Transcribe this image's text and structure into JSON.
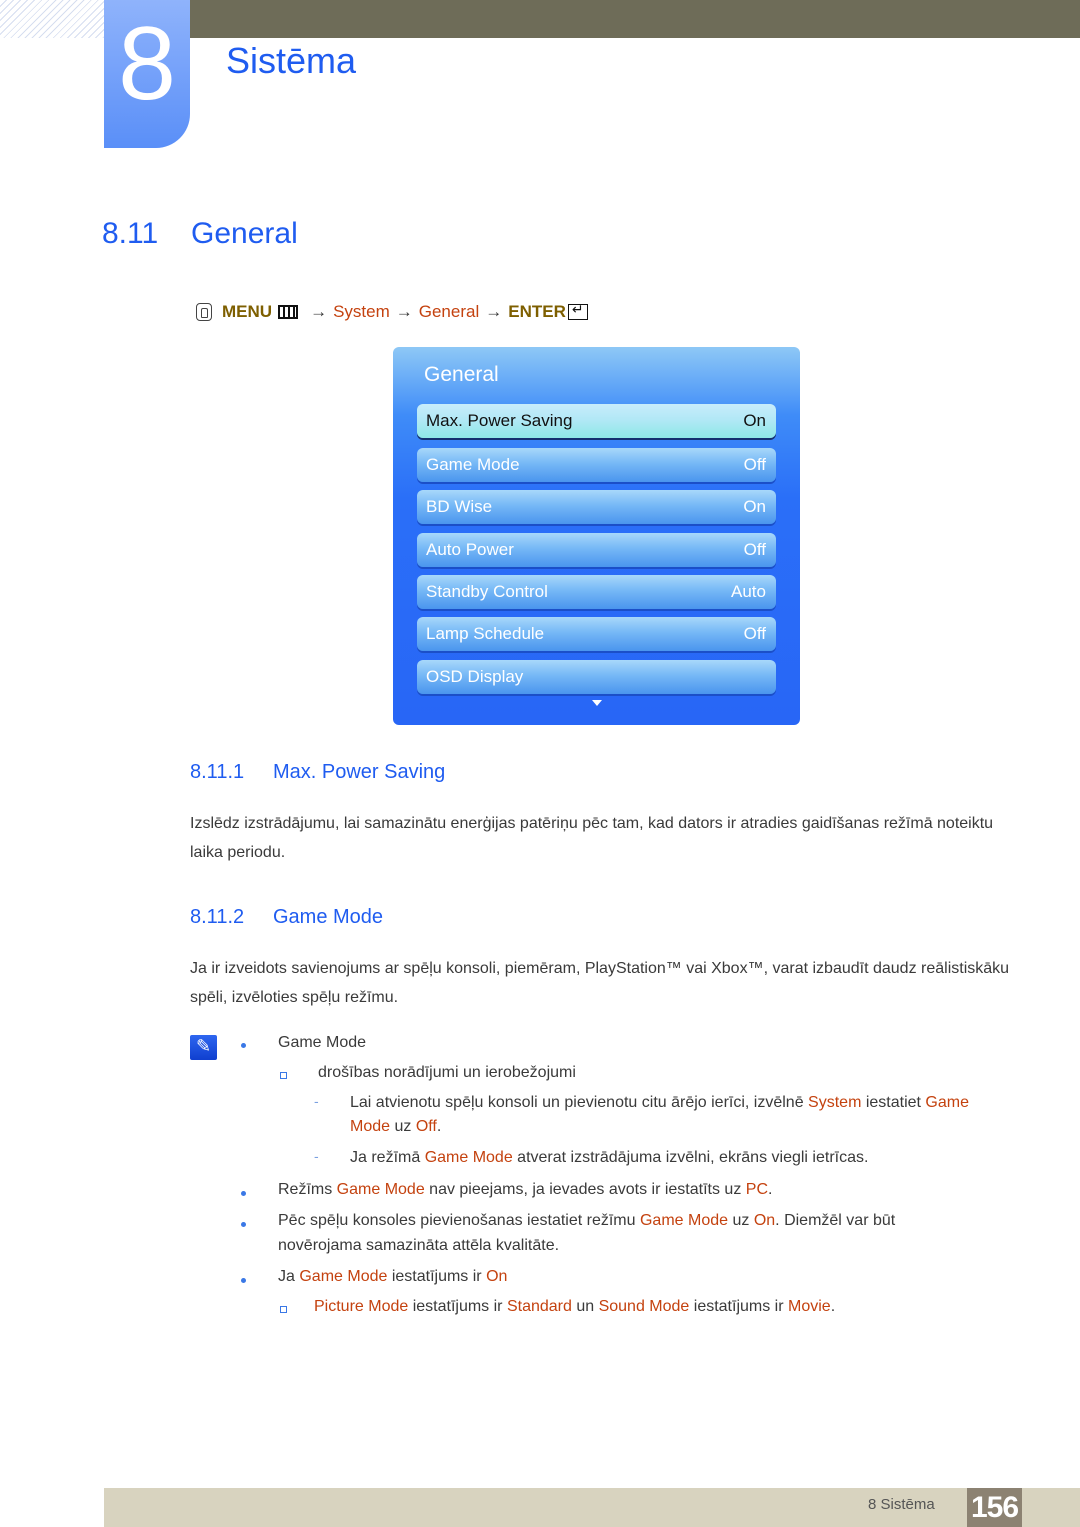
{
  "header": {
    "chapter_number": "8",
    "chapter_title": "Sistēma"
  },
  "section": {
    "number": "8.11",
    "title": "General"
  },
  "nav_path": {
    "menu": "MENU",
    "arrow": "→",
    "system": "System",
    "general": "General",
    "enter": "ENTER"
  },
  "osd": {
    "title": "General",
    "items": [
      {
        "label": "Max. Power Saving",
        "value": "On",
        "selected": true
      },
      {
        "label": "Game Mode",
        "value": "Off"
      },
      {
        "label": "BD Wise",
        "value": "On"
      },
      {
        "label": "Auto Power",
        "value": "Off"
      },
      {
        "label": "Standby Control",
        "value": "Auto"
      },
      {
        "label": "Lamp Schedule",
        "value": "Off"
      },
      {
        "label": "OSD Display",
        "value": ""
      }
    ]
  },
  "sub1": {
    "number": "8.11.1",
    "title": "Max. Power Saving",
    "body": "Izslēdz izstrādājumu, lai samazinātu enerģijas patēriņu pēc tam, kad dators ir atradies gaidīšanas režīmā noteiktu laika periodu."
  },
  "sub2": {
    "number": "8.11.2",
    "title": "Game Mode",
    "body": "Ja ir izveidots savienojums ar spēļu konsoli, piemēram, PlayStation™ vai Xbox™, varat izbaudīt daudz reālistiskāku spēli, izvēloties spēļu režīmu."
  },
  "notes": {
    "heading": "Game Mode",
    "sub_heading": "drošības norādījumi un ierobežojumi",
    "dash1": {
      "t1": "Lai atvienotu spēļu konsoli un pievienotu citu ārējo ierīci, izvēlnē ",
      "h1": "System",
      "t2": " iestatiet ",
      "h2": "Game",
      "h3": "Mode",
      "t3": " uz ",
      "h4": "Off",
      "t4": "."
    },
    "dash2": {
      "t1": "Ja režīmā ",
      "h1": "Game Mode",
      "t2": " atverat izstrādājuma izvēlni, ekrāns viegli ietrīcas."
    },
    "bullet2": {
      "t1": "Režīms ",
      "h1": "Game Mode",
      "t2": " nav pieejams, ja ievades avots ir iestatīts uz ",
      "h2": "PC",
      "t3": "."
    },
    "bullet3": {
      "t1": "Pēc spēļu konsoles pievienošanas iestatiet režīmu ",
      "h1": "Game Mode",
      "t2": " uz ",
      "h2": "On",
      "t3": ". Diemžēl var būt",
      "t4": "novērojama samazināta attēla kvalitāte."
    },
    "bullet4": {
      "t1": "Ja ",
      "h1": "Game Mode",
      "t2": " iestatījums ir ",
      "h2": "On"
    },
    "sq2": {
      "h1": "Picture Mode",
      "t1": " iestatījums ir ",
      "h2": "Standard",
      "t2": " un ",
      "h3": "Sound Mode",
      "t3": " iestatījums ir ",
      "h4": "Movie",
      "t4": "."
    }
  },
  "footer": {
    "label": "8 Sistēma",
    "page": "156"
  }
}
